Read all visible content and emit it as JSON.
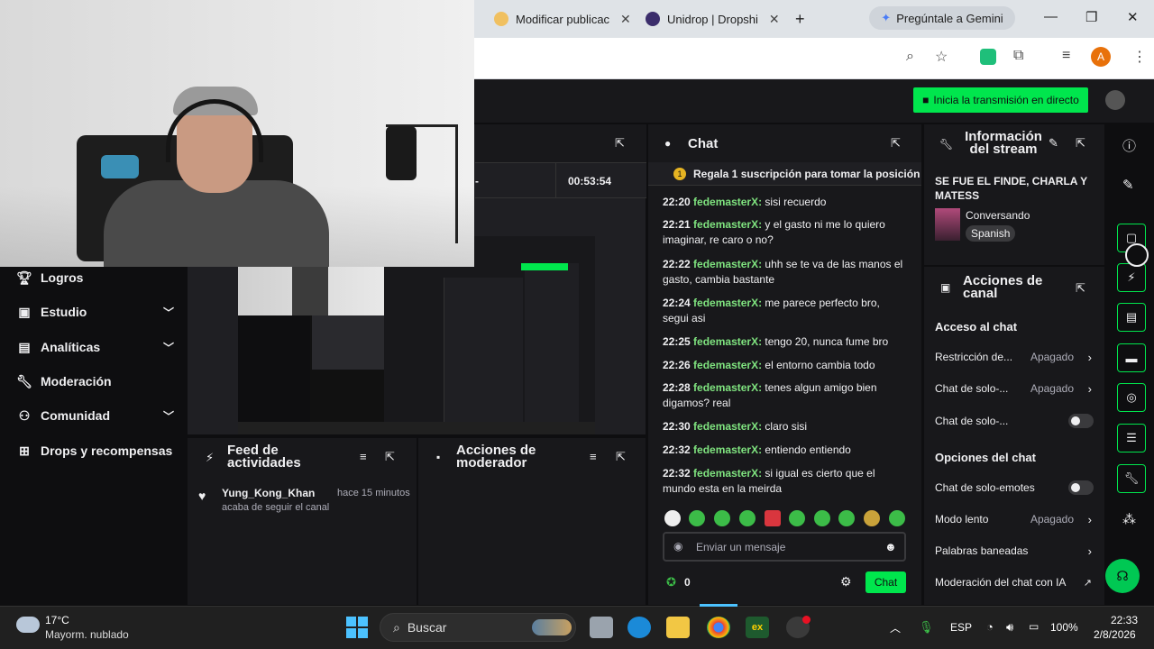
{
  "browser": {
    "tabs": [
      {
        "title": "Modificar publicac",
        "close": "✕"
      },
      {
        "title": "Unidrop | Dropshi",
        "close": "✕"
      }
    ],
    "new_tab": "+",
    "gemini_label": "Pregúntale a Gemini",
    "profile_initial": "A"
  },
  "header": {
    "go_live_label": "Inicia la transmisión en directo"
  },
  "nav": {
    "items": [
      {
        "label": "Logros",
        "icon": "trophy-icon",
        "chevron": false
      },
      {
        "label": "Estudio",
        "icon": "studio-icon",
        "chevron": true
      },
      {
        "label": "Analíticas",
        "icon": "analytics-icon",
        "chevron": true
      },
      {
        "label": "Moderación",
        "icon": "wrench-icon",
        "chevron": false
      },
      {
        "label": "Comunidad",
        "icon": "community-icon",
        "chevron": true
      },
      {
        "label": "Drops y recompensas",
        "icon": "drops-icon",
        "chevron": false
      }
    ]
  },
  "preview": {
    "dash": "-",
    "uptime": "00:53:54"
  },
  "activity": {
    "title": "Feed de actividades",
    "item": {
      "user": "Yung_Kong_Khan",
      "time": "hace 15 minutos",
      "text": "acaba de seguir el canal"
    }
  },
  "mod_actions": {
    "title": "Acciones de moderador"
  },
  "chat": {
    "title": "Chat",
    "pinned": "Regala 1 suscripción para tomar la posición ",
    "messages": [
      {
        "time": "22:20",
        "user": "fedemasterX:",
        "text": "sisi recuerdo"
      },
      {
        "time": "22:21",
        "user": "fedemasterX:",
        "text": "y el gasto ni me lo quiero imaginar, re caro o no?"
      },
      {
        "time": "22:22",
        "user": "fedemasterX:",
        "text": "uhh se te va de las manos el gasto, cambia bastante"
      },
      {
        "time": "22:24",
        "user": "fedemasterX:",
        "text": "me parece perfecto bro, segui asi"
      },
      {
        "time": "22:25",
        "user": "fedemasterX:",
        "text": "tengo 20, nunca fume bro"
      },
      {
        "time": "22:26",
        "user": "fedemasterX:",
        "text": "el entorno cambia todo"
      },
      {
        "time": "22:28",
        "user": "fedemasterX:",
        "text": "tenes algun amigo bien digamos? real"
      },
      {
        "time": "22:30",
        "user": "fedemasterX:",
        "text": "claro sisi"
      },
      {
        "time": "22:32",
        "user": "fedemasterX:",
        "text": "entiendo entiendo"
      },
      {
        "time": "22:32",
        "user": "fedemasterX:",
        "text": "si igual es cierto que el mundo esta en la meirda"
      }
    ],
    "input_placeholder": "Enviar un mensaje",
    "points": "0",
    "send_label": "Chat"
  },
  "stream_info": {
    "title": "Información del stream",
    "stream_title": "SE FUE EL FINDE, CHARLA Y MATESS",
    "category": "Conversando",
    "language": "Spanish"
  },
  "channel_actions": {
    "title": "Acciones de canal",
    "chat_access_header": "Acceso al chat",
    "rows_access": [
      {
        "label": "Restricción de...",
        "value": "Apagado",
        "type": "arrow"
      },
      {
        "label": "Chat de solo-...",
        "value": "Apagado",
        "type": "arrow"
      },
      {
        "label": "Chat de solo-...",
        "value": "",
        "type": "toggle"
      }
    ],
    "chat_options_header": "Opciones del chat",
    "rows_options": [
      {
        "label": "Chat de solo-emotes",
        "value": "",
        "type": "toggle"
      },
      {
        "label": "Modo lento",
        "value": "Apagado",
        "type": "arrow"
      },
      {
        "label": "Palabras baneadas",
        "value": "",
        "type": "arrow"
      },
      {
        "label": "Moderación del chat con IA",
        "value": "",
        "type": "external"
      }
    ]
  },
  "taskbar": {
    "weather_temp": "17°C",
    "weather_desc": "Mayorm. nublado",
    "search_label": "Buscar",
    "lang": "ESP",
    "battery": "100%",
    "time": "22:33",
    "date": "2/8/2026"
  },
  "colors": {
    "accent_green": "#00e64d",
    "username_green": "#7fe37f",
    "panel_bg": "#18181b",
    "page_bg": "#0e0e10"
  }
}
